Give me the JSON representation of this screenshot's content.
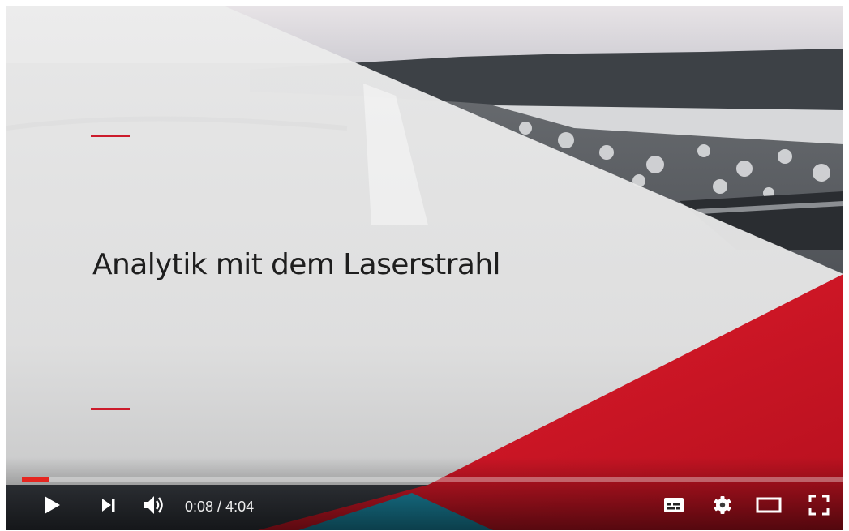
{
  "video": {
    "title": "Analytik mit dem Laserstrahl",
    "accent_color": "#cc1b2b",
    "background_scene": "snowy forest and highway from above"
  },
  "player": {
    "current_time": "0:08",
    "time_separator": " / ",
    "duration": "4:04",
    "progress_fraction": 0.033,
    "progress_color": "#e52620",
    "buttons": [
      {
        "name": "play",
        "icon": "play-icon"
      },
      {
        "name": "next",
        "icon": "skip-next-icon"
      },
      {
        "name": "volume",
        "icon": "volume-icon"
      },
      {
        "name": "subtitles",
        "icon": "subtitles-icon"
      },
      {
        "name": "settings",
        "icon": "gear-icon"
      },
      {
        "name": "theater-mode",
        "icon": "theater-icon"
      },
      {
        "name": "fullscreen",
        "icon": "fullscreen-icon"
      }
    ]
  }
}
